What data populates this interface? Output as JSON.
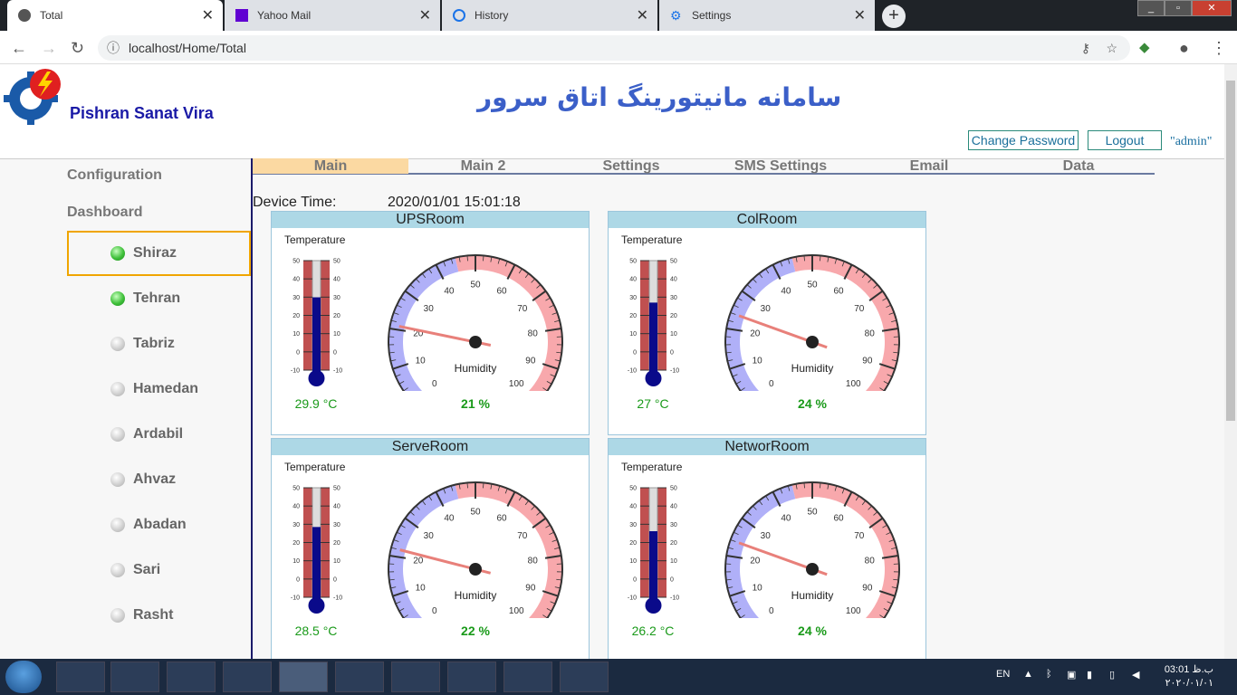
{
  "browser": {
    "tabs": [
      {
        "title": "Total",
        "icon": "globe-icon",
        "active": true
      },
      {
        "title": "Yahoo Mail",
        "icon": "yahoo-mail-icon",
        "active": false
      },
      {
        "title": "History",
        "icon": "history-icon",
        "active": false
      },
      {
        "title": "Settings",
        "icon": "gear-icon",
        "active": false
      }
    ],
    "url": "localhost/Home/Total"
  },
  "header": {
    "brand": "Pishran Sanat Vira",
    "title": "سامانه مانیتورینگ اتاق سرور",
    "change_password": "Change Password",
    "logout": "Logout",
    "user": "\"admin\""
  },
  "sidebar": {
    "configuration": "Configuration",
    "dashboard": "Dashboard",
    "cities": [
      {
        "name": "Shiraz",
        "online": true
      },
      {
        "name": "Tehran",
        "online": true
      },
      {
        "name": "Tabriz",
        "online": false
      },
      {
        "name": "Hamedan",
        "online": false
      },
      {
        "name": "Ardabil",
        "online": false
      },
      {
        "name": "Ahvaz",
        "online": false
      },
      {
        "name": "Abadan",
        "online": false
      },
      {
        "name": "Sari",
        "online": false
      },
      {
        "name": "Rasht",
        "online": false
      }
    ]
  },
  "menu": [
    "Main",
    "Main 2",
    "Settings",
    "SMS Settings",
    "Email",
    "Data"
  ],
  "device_time_label": "Device Time:",
  "device_time": "2020/01/01 15:01:18",
  "panel_labels": {
    "temperature": "Temperature",
    "humidity": "Humidity"
  },
  "rooms": [
    {
      "name": "UPSRoom",
      "temp_c": 29.9,
      "temp_text": "29.9 °C",
      "humidity": 21,
      "hum_text": "21 %"
    },
    {
      "name": "ColRoom",
      "temp_c": 27,
      "temp_text": "27 °C",
      "humidity": 24,
      "hum_text": "24 %"
    },
    {
      "name": "ServeRoom",
      "temp_c": 28.5,
      "temp_text": "28.5 °C",
      "humidity": 22,
      "hum_text": "22 %"
    },
    {
      "name": "NetworRoom",
      "temp_c": 26.2,
      "temp_text": "26.2 °C",
      "humidity": 24,
      "hum_text": "24 %"
    }
  ],
  "thermometer_ticks": [
    "50",
    "40",
    "30",
    "20",
    "10",
    "0",
    "-10"
  ],
  "gauge_ticks": [
    "0",
    "10",
    "20",
    "30",
    "40",
    "50",
    "60",
    "70",
    "80",
    "90",
    "100"
  ],
  "taskbar": {
    "lang": "EN",
    "time": "03:01 ب.ظ",
    "date": "۲۰۲۰/۰۱/۰۱"
  },
  "colors": {
    "header_title": "#3b5fc8",
    "panel_header": "#add8e6",
    "value_green": "#1a9a1a",
    "menu_active": "#fbd9a2"
  }
}
